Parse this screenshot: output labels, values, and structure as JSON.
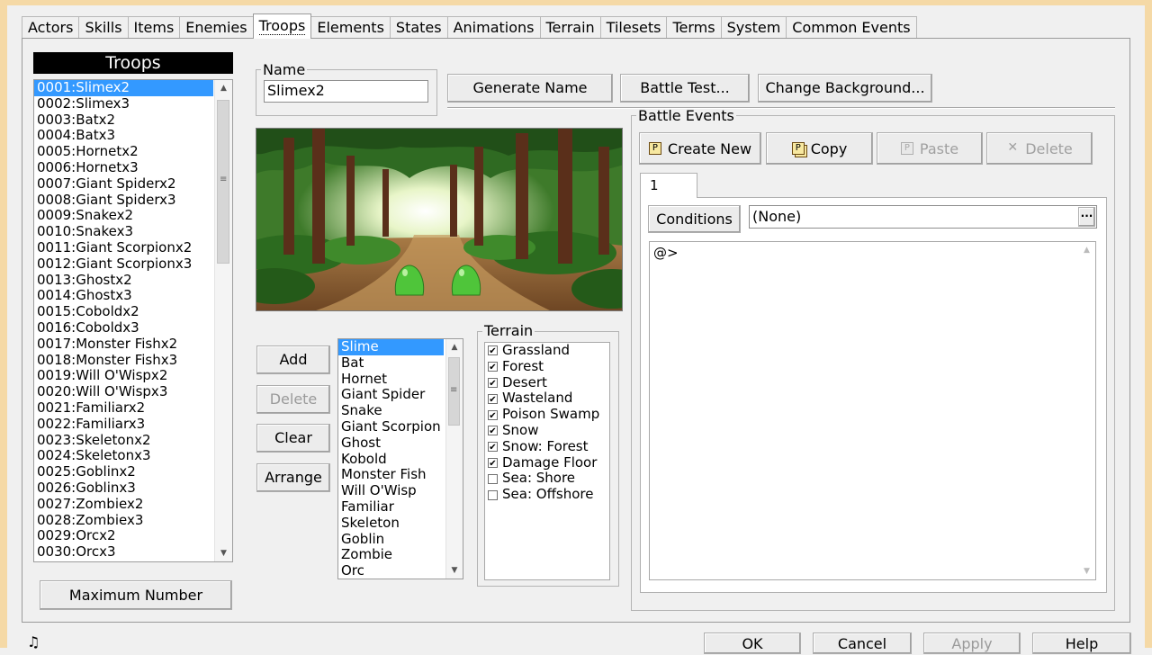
{
  "tabs": [
    "Actors",
    "Skills",
    "Items",
    "Enemies",
    "Troops",
    "Elements",
    "States",
    "Animations",
    "Terrain",
    "Tilesets",
    "Terms",
    "System",
    "Common Events"
  ],
  "active_tab": "Troops",
  "troops": {
    "header": "Troops",
    "items": [
      "0001:Slimex2",
      "0002:Slimex3",
      "0003:Batx2",
      "0004:Batx3",
      "0005:Hornetx2",
      "0006:Hornetx3",
      "0007:Giant Spiderx2",
      "0008:Giant Spiderx3",
      "0009:Snakex2",
      "0010:Snakex3",
      "0011:Giant Scorpionx2",
      "0012:Giant Scorpionx3",
      "0013:Ghostx2",
      "0014:Ghostx3",
      "0015:Coboldx2",
      "0016:Coboldx3",
      "0017:Monster Fishx2",
      "0018:Monster Fishx3",
      "0019:Will O'Wispx2",
      "0020:Will O'Wispx3",
      "0021:Familiarx2",
      "0022:Familiarx3",
      "0023:Skeletonx2",
      "0024:Skeletonx3",
      "0025:Goblinx2",
      "0026:Goblinx3",
      "0027:Zombiex2",
      "0028:Zombiex3",
      "0029:Orcx2",
      "0030:Orcx3"
    ],
    "selected_index": 0,
    "max_button": "Maximum Number"
  },
  "name": {
    "label": "Name",
    "value": "Slimex2"
  },
  "top_buttons": {
    "generate": "Generate Name",
    "battle_test": "Battle Test...",
    "change_bg": "Change Background..."
  },
  "member_buttons": {
    "add": "Add",
    "delete": "Delete",
    "clear": "Clear",
    "arrange": "Arrange"
  },
  "enemies": {
    "items": [
      "Slime",
      "Bat",
      "Hornet",
      "Giant Spider",
      "Snake",
      "Giant Scorpion",
      "Ghost",
      "Kobold",
      "Monster Fish",
      "Will O'Wisp",
      "Familiar",
      "Skeleton",
      "Goblin",
      "Zombie",
      "Orc"
    ],
    "selected_index": 0
  },
  "terrain": {
    "label": "Terrain",
    "items": [
      {
        "name": "Grassland",
        "checked": true
      },
      {
        "name": "Forest",
        "checked": true
      },
      {
        "name": "Desert",
        "checked": true
      },
      {
        "name": "Wasteland",
        "checked": true
      },
      {
        "name": "Poison Swamp",
        "checked": true
      },
      {
        "name": "Snow",
        "checked": true
      },
      {
        "name": "Snow: Forest",
        "checked": true
      },
      {
        "name": "Damage Floor",
        "checked": true
      },
      {
        "name": "Sea: Shore",
        "checked": false
      },
      {
        "name": "Sea: Offshore",
        "checked": false
      }
    ]
  },
  "battle_events": {
    "label": "Battle Events",
    "create_new": "Create New",
    "copy": "Copy",
    "paste": "Paste",
    "delete": "Delete",
    "page_tab": "1",
    "conditions_label": "Conditions",
    "conditions_value": "(None)",
    "more_button": "...",
    "event_line": "@>"
  },
  "bottom": {
    "ok": "OK",
    "cancel": "Cancel",
    "apply": "Apply",
    "help": "Help",
    "music_icon": "music-note-icon"
  }
}
